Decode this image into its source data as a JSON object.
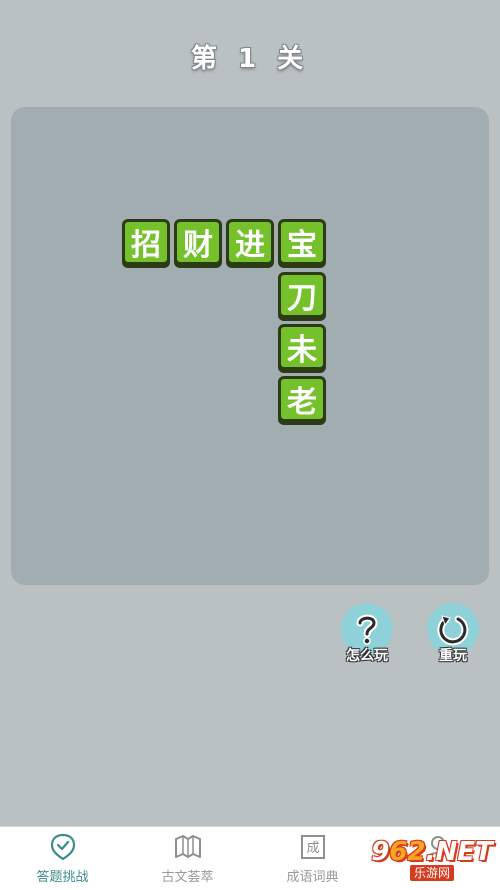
{
  "level": {
    "title": "第 1 关"
  },
  "board": {
    "tiles": [
      {
        "char": "招"
      },
      {
        "char": "财"
      },
      {
        "char": "进"
      },
      {
        "char": "宝"
      },
      {
        "char": "刀"
      },
      {
        "char": "未"
      },
      {
        "char": "老"
      }
    ]
  },
  "actions": {
    "help_label": "怎么玩",
    "restart_label": "重玩"
  },
  "tabs": [
    {
      "label": "答题挑战",
      "icon": "check-badge-icon",
      "active": true
    },
    {
      "label": "古文荟萃",
      "icon": "book-icon",
      "active": false
    },
    {
      "label": "成语词典",
      "icon": "dictionary-icon",
      "active": false
    },
    {
      "label": "",
      "icon": "profile-icon",
      "active": false
    }
  ],
  "watermark": {
    "main_prefix": "9",
    "main_num": "62",
    "main_suffix": ".NET",
    "sub": "乐游网"
  },
  "colors": {
    "background": "#b9c1c3",
    "board": "#a1adb0",
    "tile": "#74c12b",
    "tile_border": "#2c3a16",
    "button": "#8fd1d8",
    "tab_active": "#3d8a8e"
  }
}
